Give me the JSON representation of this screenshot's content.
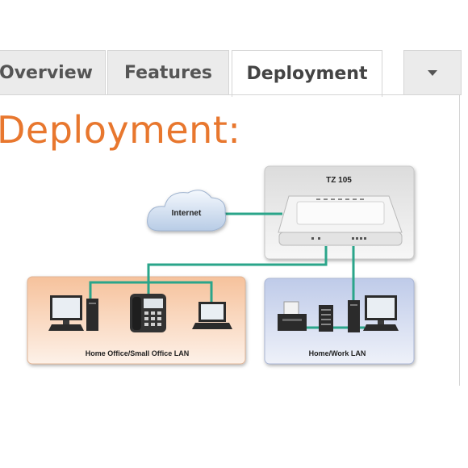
{
  "tabs": {
    "overview": "Overview",
    "features": "Features",
    "deployment": "Deployment"
  },
  "heading": "Deployment:",
  "diagram": {
    "device_label": "TZ 105",
    "cloud_label": "Internet",
    "lan_left_label": "Home Office/Small Office LAN",
    "lan_right_label": "Home/Work LAN"
  },
  "colors": {
    "heading": "#e8772e",
    "link": "#2aa58a",
    "lan_left_bg": "#f7cfb2",
    "lan_right_bg": "#cfd8ee"
  },
  "icons": [
    "chevron-down-icon",
    "cloud-icon",
    "firewall-appliance-icon",
    "desktop-computer-icon",
    "ip-phone-icon",
    "laptop-icon",
    "printer-icon",
    "network-switch-icon"
  ]
}
